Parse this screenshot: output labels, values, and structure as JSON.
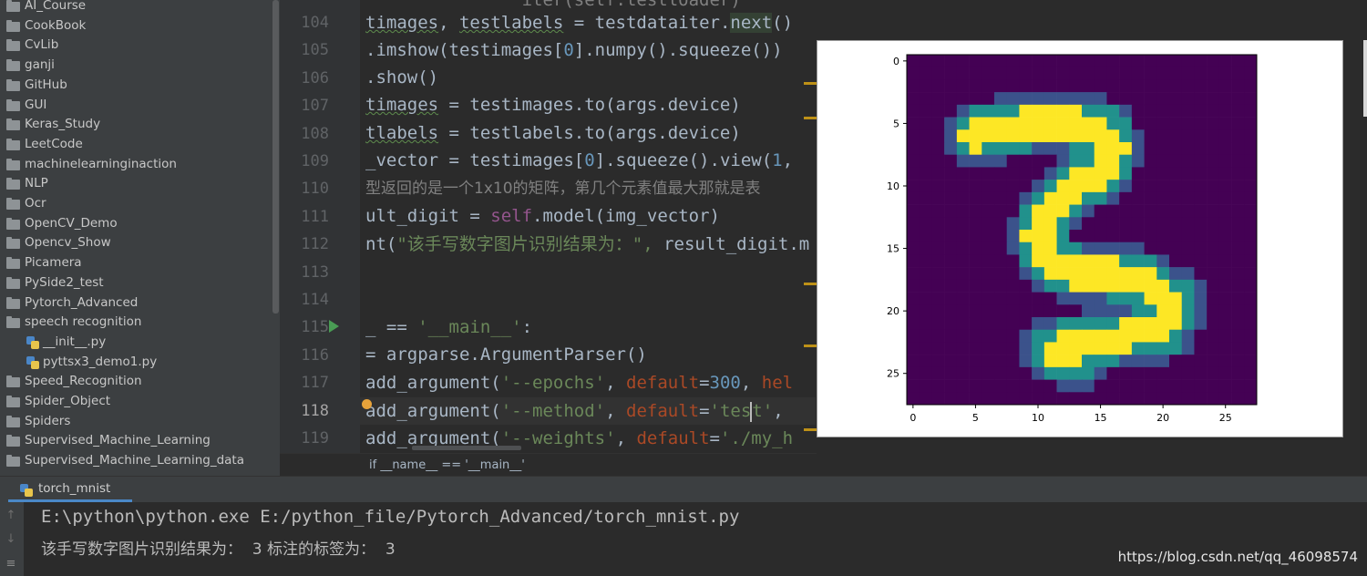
{
  "tree": {
    "folders": [
      "AI_Course",
      "CookBook",
      "CvLib",
      "ganji",
      "GitHub",
      "GUI",
      "Keras_Study",
      "LeetCode",
      "machinelearninginaction",
      "NLP",
      "Ocr",
      "OpenCV_Demo",
      "Opencv_Show",
      "Picamera",
      "PySide2_test",
      "Pytorch_Advanced",
      "speech recognition"
    ],
    "files": [
      "__init__.py",
      "pyttsx3_demo1.py"
    ],
    "after": [
      "Speed_Recognition",
      "Spider_Object",
      "Spiders",
      "Supervised_Machine_Learning",
      "Supervised_Machine_Learning_data"
    ]
  },
  "editor": {
    "line_numbers": [
      "104",
      "105",
      "106",
      "107",
      "108",
      "109",
      "110",
      "111",
      "112",
      "113",
      "114",
      "115",
      "116",
      "117",
      "118",
      "119"
    ],
    "current_line": "118",
    "breadcrumb": "if __name__ == '__main__'"
  },
  "figure": {
    "x_ticks": [
      "0",
      "5",
      "10",
      "15",
      "20",
      "25"
    ],
    "y_ticks": [
      "0",
      "5",
      "10",
      "15",
      "20",
      "25"
    ]
  },
  "run": {
    "tab_label": "torch_mnist",
    "console_line1": "E:\\python\\python.exe E:/python_file/Pytorch_Advanced/torch_mnist.py",
    "console_line2": "该手写数字图片识别结果为：  3 标注的标签为：  3"
  },
  "watermark": "https://blog.csdn.net/qq_46098574",
  "colors": {
    "viridis_dark": "#440154",
    "viridis_yellow": "#fde725",
    "viridis_teal": "#21918c",
    "viridis_green": "#5ec962"
  },
  "icons": [
    "folder-icon",
    "python-file-icon",
    "run-arrow-icon",
    "bulb-icon"
  ]
}
